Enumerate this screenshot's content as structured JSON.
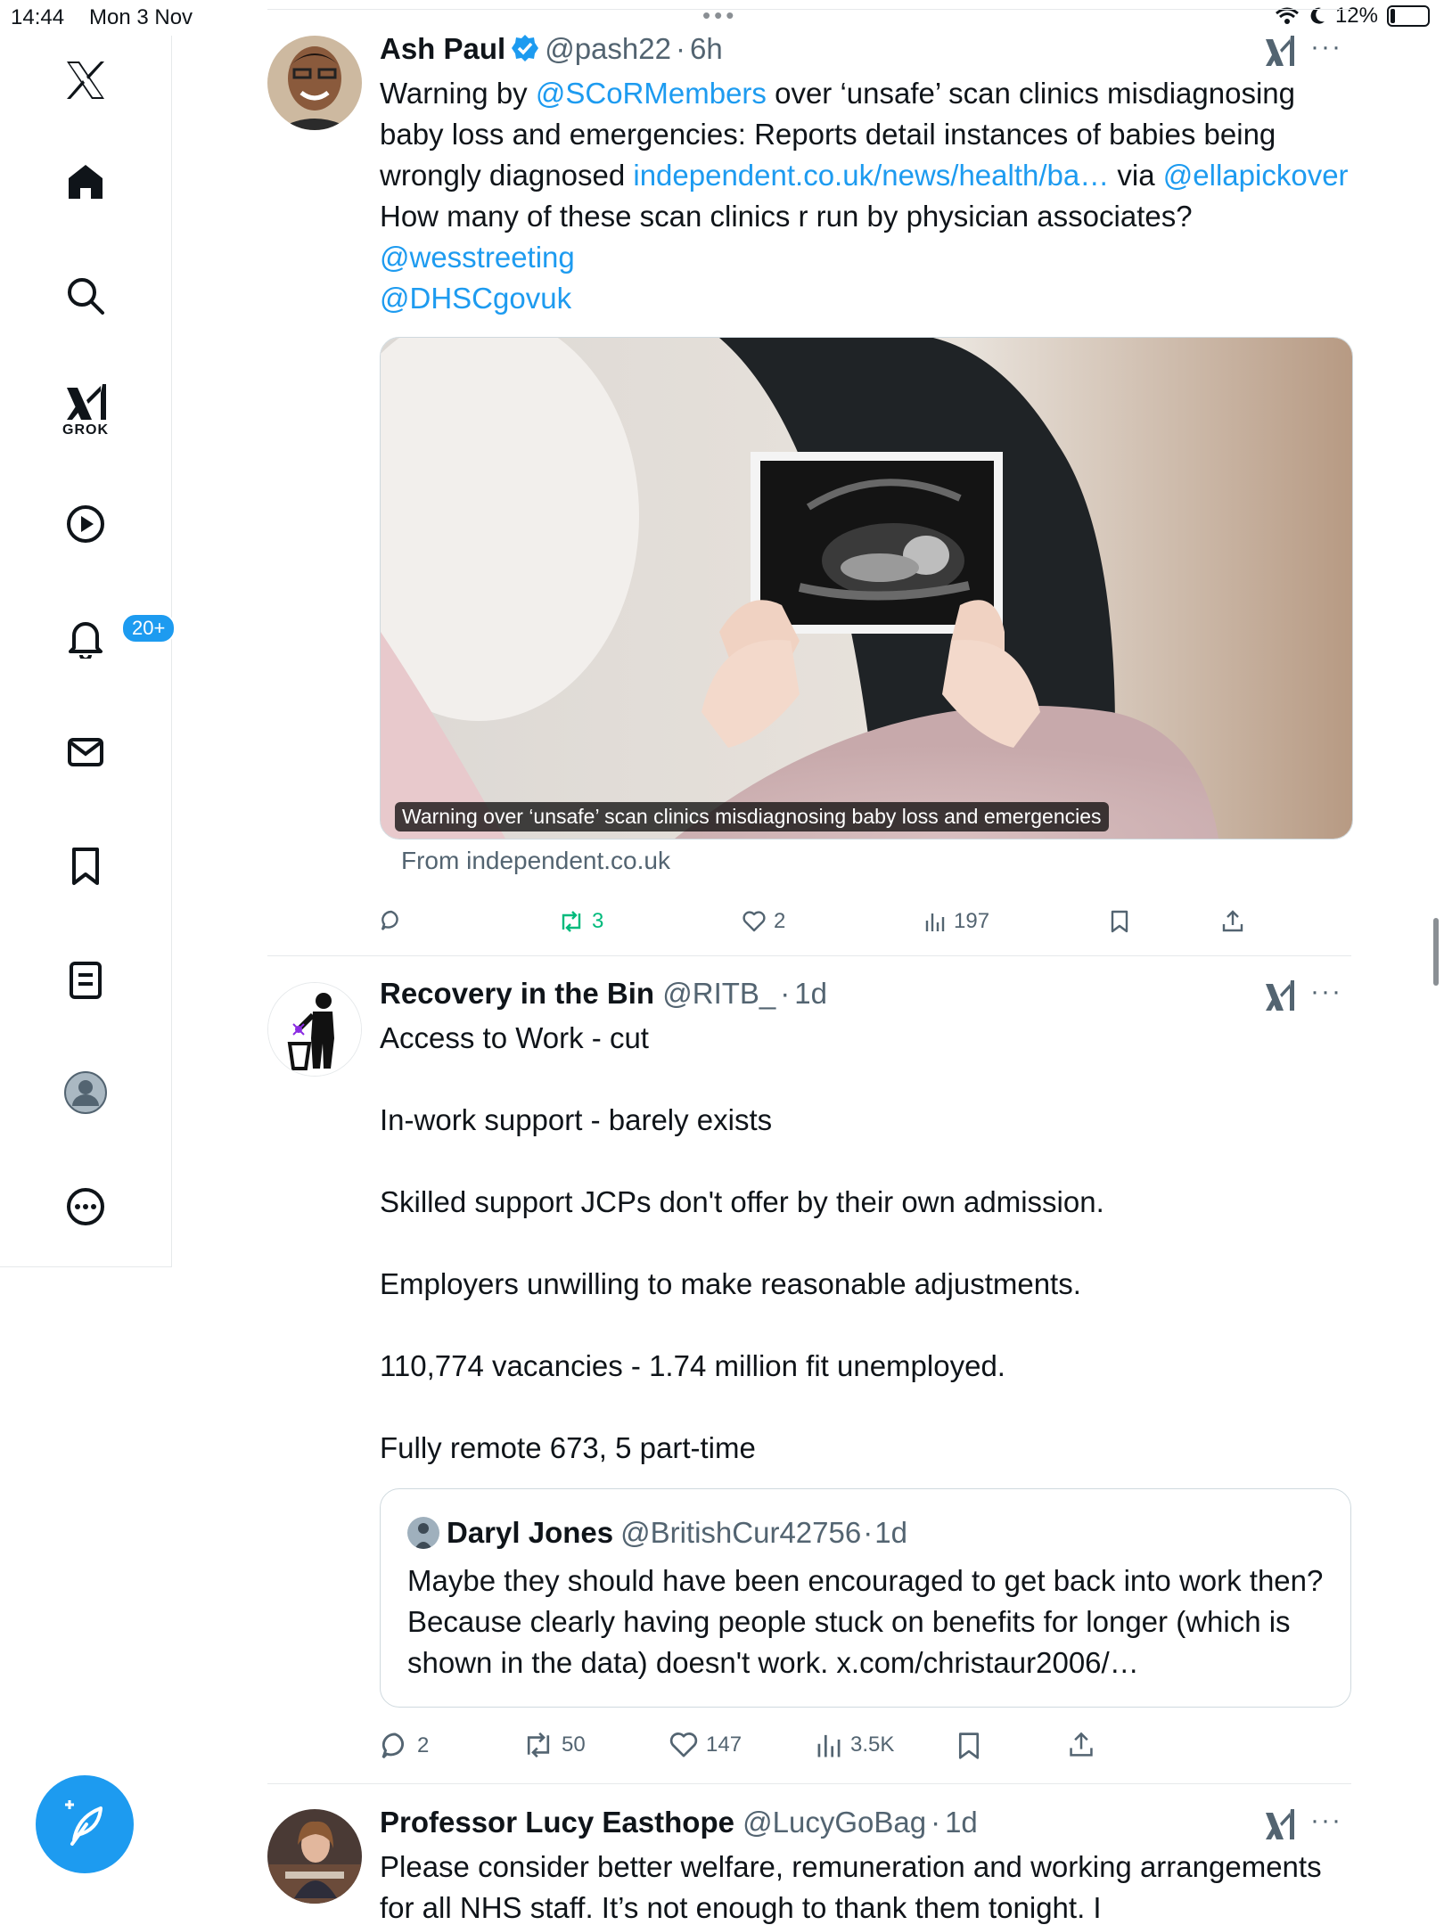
{
  "status_bar": {
    "time": "14:44",
    "date": "Mon 3 Nov",
    "battery": "12%",
    "battery_fraction": 0.12
  },
  "sidebar": {
    "items": [
      {
        "name": "x-logo"
      },
      {
        "name": "home"
      },
      {
        "name": "search"
      },
      {
        "name": "grok",
        "label": "GROK"
      },
      {
        "name": "video"
      },
      {
        "name": "notifications",
        "badge": "20+"
      },
      {
        "name": "messages"
      },
      {
        "name": "bookmarks"
      },
      {
        "name": "lists"
      },
      {
        "name": "profile"
      },
      {
        "name": "more"
      }
    ]
  },
  "colors": {
    "accent": "#1d9bf0",
    "text": "#0f1419",
    "muted": "#536471",
    "repost_active": "#00ba7c",
    "border": "#e6e9eb"
  },
  "tweets": [
    {
      "name": "Ash Paul",
      "handle": "@pash22",
      "sep": "·",
      "time": "6h",
      "verified": true,
      "text": {
        "p1": "Warning by ",
        "m1": "@SCoRMembers",
        "p2": " over ‘unsafe’ scan clinics misdiagnosing baby loss and emergencies: Reports detail instances of babies being wrongly diagnosed ",
        "link": "independent.co.uk/news/health/ba…",
        "p3": " via ",
        "m2": "@ellapickover",
        "p4": " How many of these scan clinics r run by physician associates? ",
        "m3": "@wesstreeting",
        "m4": "@DHSCgovuk"
      },
      "card": {
        "caption": "Warning over ‘unsafe’ scan clinics misdiagnosing baby loss and emergencies",
        "from": "From independent.co.uk"
      },
      "stats": {
        "replies": "",
        "reposts": "3",
        "likes": "2",
        "views": "197"
      }
    },
    {
      "name": "Recovery in the Bin",
      "handle": "@RITB_",
      "sep": "·",
      "time": "1d",
      "lines": [
        "Access to Work - cut",
        "In-work support - barely exists",
        "Skilled support JCPs don't offer by their own admission.",
        "Employers unwilling to make reasonable adjustments.",
        "110,774 vacancies - 1.74 million fit unemployed.",
        "Fully remote 673, 5 part-time"
      ],
      "quote": {
        "name": "Daryl Jones",
        "handle": "@BritishCur42756",
        "sep": "·",
        "time": "1d",
        "text": "Maybe they should have been encouraged to get back into work then? Because clearly having people stuck on benefits for longer (which is shown in the data) doesn't work. x.com/christaur2006/…"
      },
      "stats": {
        "replies": "2",
        "reposts": "50",
        "likes": "147",
        "views": "3.5K"
      }
    },
    {
      "name": "Professor Lucy Easthope",
      "handle": "@LucyGoBag",
      "sep": "·",
      "time": "1d",
      "text": "Please consider better welfare, remuneration and working arrangements for all NHS staff. It’s not enough to thank them tonight. I"
    }
  ]
}
